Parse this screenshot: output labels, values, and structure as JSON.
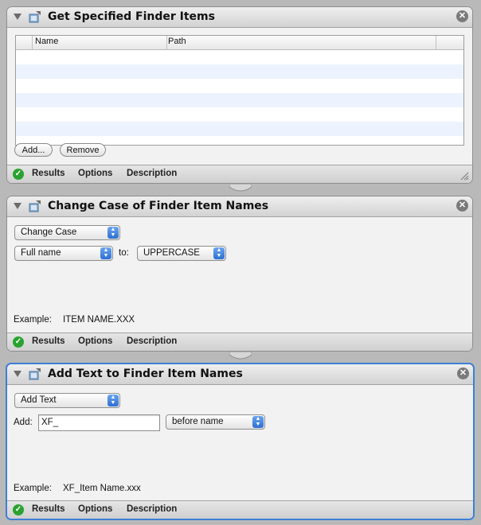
{
  "actions": [
    {
      "title": "Get Specified Finder Items",
      "table": {
        "columns": [
          "Name",
          "Path"
        ],
        "rows": []
      },
      "buttons": {
        "add": "Add...",
        "remove": "Remove"
      },
      "footer": {
        "results": "Results",
        "options": "Options",
        "description": "Description"
      }
    },
    {
      "title": "Change Case of Finder Item Names",
      "popup_mode": "Change Case",
      "popup_scope": "Full name",
      "to_label": "to:",
      "popup_case": "UPPERCASE",
      "example_label": "Example:",
      "example_value": "ITEM NAME.XXX",
      "footer": {
        "results": "Results",
        "options": "Options",
        "description": "Description"
      }
    },
    {
      "title": "Add Text to Finder Item Names",
      "popup_mode": "Add Text",
      "add_label": "Add:",
      "add_value": "XF_",
      "popup_position": "before name",
      "example_label": "Example:",
      "example_value": "XF_Item Name.xxx",
      "footer": {
        "results": "Results",
        "options": "Options",
        "description": "Description"
      }
    }
  ],
  "colors": {
    "selected_border": "#3d7fd6",
    "status_ok": "#2aa22f",
    "alt_row": "#edf3fe"
  }
}
